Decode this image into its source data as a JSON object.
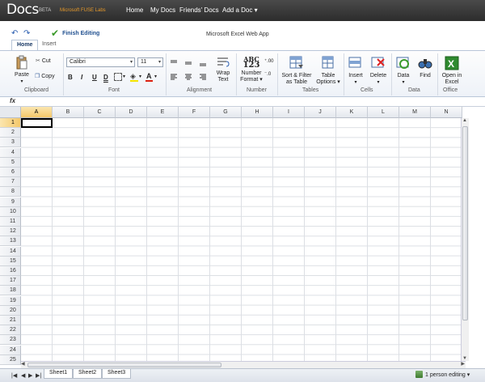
{
  "topbar": {
    "logo": "Docs",
    "beta": "BETA",
    "fuse": "Microsoft FUSE Labs",
    "nav": [
      "Home",
      "My Docs",
      "Friends' Docs",
      "Add a Doc ▾"
    ]
  },
  "title": {
    "finish_editing": "Finish Editing",
    "app_title": "Microsoft Excel Web App"
  },
  "tabs": [
    "Home",
    "Insert"
  ],
  "ribbon": {
    "clipboard": {
      "paste": "Paste",
      "cut": "Cut",
      "copy": "Copy",
      "label": "Clipboard"
    },
    "font": {
      "family": "Calibri",
      "size": "11",
      "bold": "B",
      "italic": "I",
      "underline": "U",
      "double_underline": "D",
      "label": "Font"
    },
    "alignment": {
      "wrap": "Wrap Text",
      "label": "Alignment"
    },
    "number": {
      "abc": "ABC",
      "num": "123",
      "format": "Number Format ▾",
      "label": "Number"
    },
    "tables": {
      "sort": "Sort & Filter as Table",
      "options": "Table Options ▾",
      "label": "Tables"
    },
    "cells": {
      "insert": "Insert",
      "delete": "Delete",
      "label": "Cells"
    },
    "data": {
      "data": "Data",
      "find": "Find",
      "label": "Data"
    },
    "office": {
      "open": "Open in Excel",
      "label": "Office"
    }
  },
  "formula_bar": {
    "fx": "fx"
  },
  "columns": [
    "A",
    "B",
    "C",
    "D",
    "E",
    "F",
    "G",
    "H",
    "I",
    "J",
    "K",
    "L",
    "M",
    "N"
  ],
  "rows": [
    "1",
    "2",
    "3",
    "4",
    "5",
    "6",
    "7",
    "8",
    "9",
    "10",
    "11",
    "12",
    "13",
    "14",
    "15",
    "16",
    "17",
    "18",
    "19",
    "20",
    "21",
    "22",
    "23",
    "24",
    "25"
  ],
  "sheets": [
    "Sheet1",
    "Sheet2",
    "Sheet3"
  ],
  "status": {
    "editing": "1 person editing ▾"
  }
}
